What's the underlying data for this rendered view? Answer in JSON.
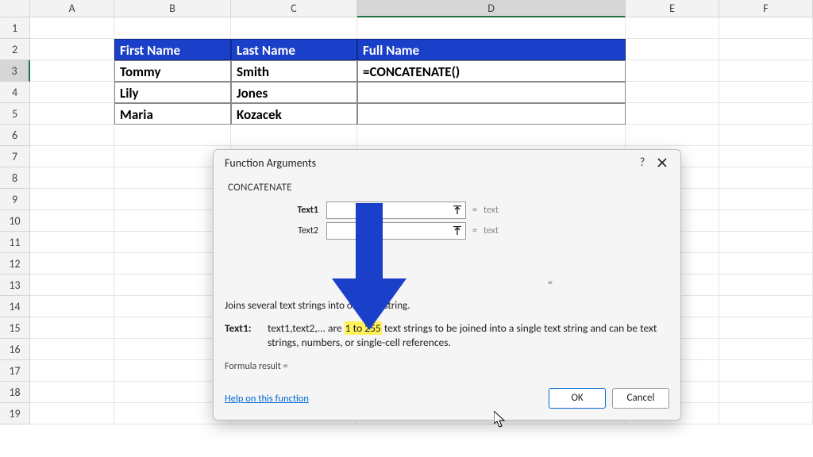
{
  "columns": [
    "A",
    "B",
    "C",
    "D",
    "E",
    "F"
  ],
  "rownums": [
    "1",
    "2",
    "3",
    "4",
    "5",
    "6",
    "7",
    "8",
    "9",
    "10",
    "11",
    "12",
    "13",
    "14",
    "15",
    "16",
    "17",
    "18",
    "19"
  ],
  "table": {
    "headers": {
      "b": "First Name",
      "c": "Last Name",
      "d": "Full Name"
    },
    "rows": [
      {
        "b": "Tommy",
        "c": "Smith",
        "d": "=CONCATENATE()"
      },
      {
        "b": "Lily",
        "c": "Jones",
        "d": ""
      },
      {
        "b": "Maria",
        "c": "Kozacek",
        "d": ""
      }
    ]
  },
  "dialog": {
    "title": "Function Arguments",
    "help_glyph": "?",
    "fn": "CONCATENATE",
    "args": [
      {
        "label": "Text1",
        "bold": true,
        "value": "",
        "type": "text"
      },
      {
        "label": "Text2",
        "bold": false,
        "value": "",
        "type": "text"
      }
    ],
    "eq": "=",
    "desc": "Joins several text strings into one text string.",
    "arg_help": {
      "label": "Text1:",
      "pre": "text1,text2,... are ",
      "highlight": "1 to 255",
      "post": " text strings to be joined into a single text string and can be text strings, numbers, or single-cell references."
    },
    "result_label": "Formula result =",
    "help_link": "Help on this function",
    "ok": "OK",
    "cancel": "Cancel"
  }
}
